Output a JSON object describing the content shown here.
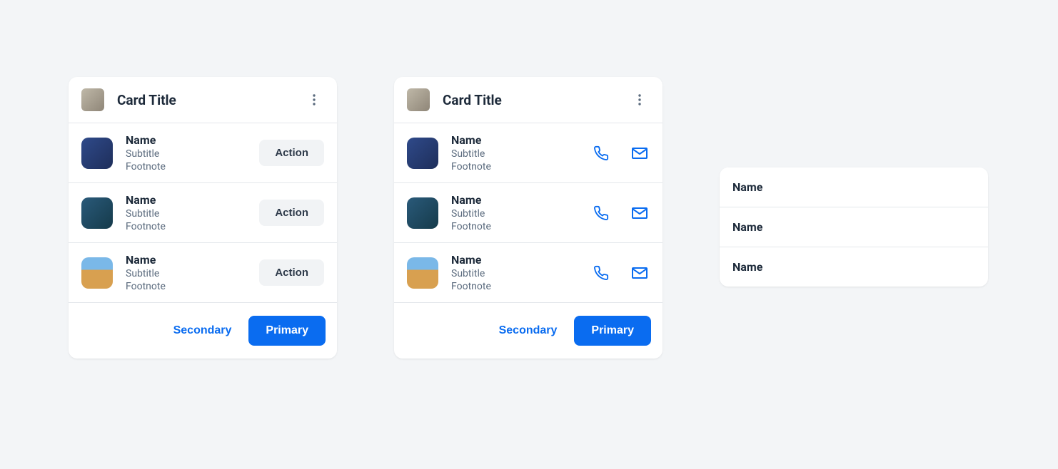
{
  "card1": {
    "title": "Card Title",
    "items": [
      {
        "name": "Name",
        "subtitle": "Subtitle",
        "footnote": "Footnote",
        "action": "Action"
      },
      {
        "name": "Name",
        "subtitle": "Subtitle",
        "footnote": "Footnote",
        "action": "Action"
      },
      {
        "name": "Name",
        "subtitle": "Subtitle",
        "footnote": "Footnote",
        "action": "Action"
      }
    ],
    "footer": {
      "secondary": "Secondary",
      "primary": "Primary"
    }
  },
  "card2": {
    "title": "Card Title",
    "items": [
      {
        "name": "Name",
        "subtitle": "Subtitle",
        "footnote": "Footnote"
      },
      {
        "name": "Name",
        "subtitle": "Subtitle",
        "footnote": "Footnote"
      },
      {
        "name": "Name",
        "subtitle": "Subtitle",
        "footnote": "Footnote"
      }
    ],
    "footer": {
      "secondary": "Secondary",
      "primary": "Primary"
    }
  },
  "card3": {
    "rows": [
      {
        "name": "Name"
      },
      {
        "name": "Name"
      },
      {
        "name": "Name"
      }
    ]
  }
}
